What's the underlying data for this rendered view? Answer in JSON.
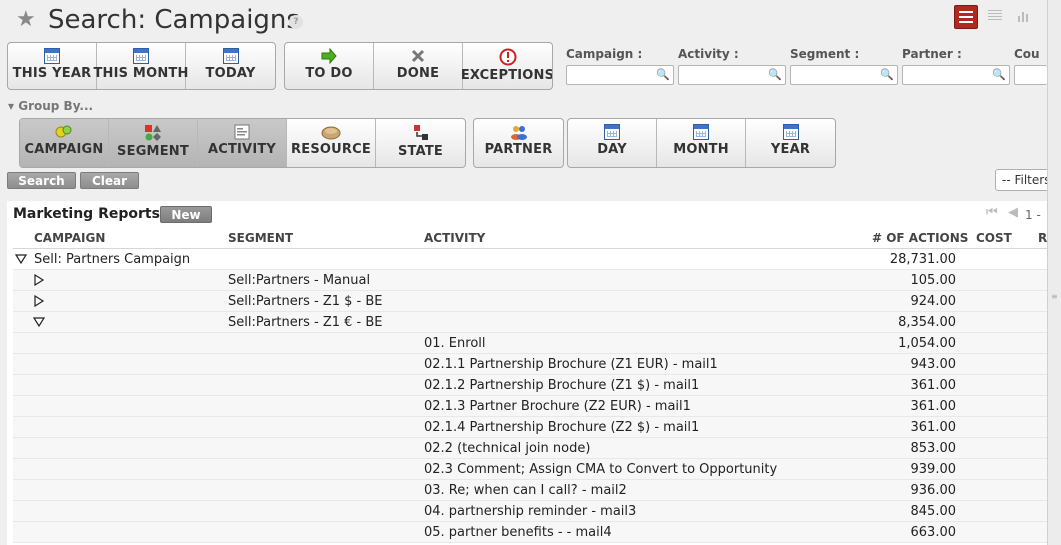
{
  "header": {
    "title": "Search: Campaigns",
    "help": "?"
  },
  "quick_filters": [
    {
      "label": "THIS YEAR",
      "icon": "calendar-icon"
    },
    {
      "label": "THIS MONTH",
      "icon": "calendar-icon"
    },
    {
      "label": "TODAY",
      "icon": "calendar-icon"
    }
  ],
  "state_filters": [
    {
      "label": "TO DO",
      "icon": "arrow-right-icon"
    },
    {
      "label": "DONE",
      "icon": "cross-icon"
    },
    {
      "label": "EXCEPTIONS",
      "icon": "exclamation-icon"
    }
  ],
  "fields": [
    {
      "label": "Campaign :"
    },
    {
      "label": "Activity :"
    },
    {
      "label": "Segment :"
    },
    {
      "label": "Partner :"
    },
    {
      "label": "Cou"
    }
  ],
  "group_by": {
    "label": "Group By...",
    "group1": [
      {
        "label": "CAMPAIGN",
        "active": true
      },
      {
        "label": "SEGMENT",
        "active": true
      },
      {
        "label": "ACTIVITY",
        "active": true
      },
      {
        "label": "RESOURCE",
        "active": false
      },
      {
        "label": "STATE",
        "active": false
      }
    ],
    "group2": [
      {
        "label": "PARTNER"
      }
    ],
    "group3": [
      {
        "label": "DAY"
      },
      {
        "label": "MONTH"
      },
      {
        "label": "YEAR"
      }
    ]
  },
  "actions": {
    "search": "Search",
    "clear": "Clear",
    "filters": "-- Filters"
  },
  "panel": {
    "title": "Marketing Reports",
    "new": "New",
    "pager": "1 - "
  },
  "table": {
    "headers": {
      "campaign": "CAMPAIGN",
      "segment": "SEGMENT",
      "activity": "ACTIVITY",
      "actions": "# OF ACTIONS",
      "cost": "COST",
      "r": "R"
    },
    "rows": [
      {
        "level": 0,
        "toggle": "expanded",
        "campaign": "Sell: Partners Campaign",
        "segment": "",
        "activity": "",
        "actions": "28,731.00"
      },
      {
        "level": 1,
        "toggle": "collapsed",
        "campaign": "",
        "segment": "Sell:Partners - Manual",
        "activity": "",
        "actions": "105.00"
      },
      {
        "level": 1,
        "toggle": "collapsed",
        "campaign": "",
        "segment": "Sell:Partners - Z1 $ - BE",
        "activity": "",
        "actions": "924.00"
      },
      {
        "level": 1,
        "toggle": "expanded",
        "campaign": "",
        "segment": "Sell:Partners - Z1 € - BE",
        "activity": "",
        "actions": "8,354.00"
      },
      {
        "level": 2,
        "toggle": "",
        "campaign": "",
        "segment": "",
        "activity": "01. Enroll",
        "actions": "1,054.00"
      },
      {
        "level": 2,
        "toggle": "",
        "campaign": "",
        "segment": "",
        "activity": "02.1.1 Partnership Brochure (Z1 EUR) - mail1",
        "actions": "943.00"
      },
      {
        "level": 2,
        "toggle": "",
        "campaign": "",
        "segment": "",
        "activity": "02.1.2 Partnership Brochure (Z1 $) - mail1",
        "actions": "361.00"
      },
      {
        "level": 2,
        "toggle": "",
        "campaign": "",
        "segment": "",
        "activity": "02.1.3 Partner Brochure (Z2 EUR) - mail1",
        "actions": "361.00"
      },
      {
        "level": 2,
        "toggle": "",
        "campaign": "",
        "segment": "",
        "activity": "02.1.4 Partnership Brochure (Z2 $) - mail1",
        "actions": "361.00"
      },
      {
        "level": 2,
        "toggle": "",
        "campaign": "",
        "segment": "",
        "activity": "02.2 (technical join node)",
        "actions": "853.00"
      },
      {
        "level": 2,
        "toggle": "",
        "campaign": "",
        "segment": "",
        "activity": "02.3 Comment; Assign CMA to Convert to Opportunity",
        "actions": "939.00"
      },
      {
        "level": 2,
        "toggle": "",
        "campaign": "",
        "segment": "",
        "activity": "03. Re; when can I call? - mail2",
        "actions": "936.00"
      },
      {
        "level": 2,
        "toggle": "",
        "campaign": "",
        "segment": "",
        "activity": "04. partnership reminder - mail3",
        "actions": "845.00"
      },
      {
        "level": 2,
        "toggle": "",
        "campaign": "",
        "segment": "",
        "activity": "05. partner benefits - - mail4",
        "actions": "663.00"
      }
    ]
  },
  "colors": {
    "accent": "#b22a1f",
    "active_group": "#b9b9b9"
  }
}
